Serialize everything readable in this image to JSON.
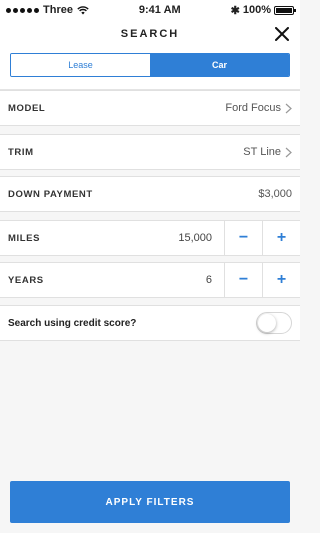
{
  "status_bar": {
    "carrier": "Three",
    "time": "9:41 AM",
    "battery": "100%",
    "battery_level": 1.0
  },
  "header": {
    "title": "SEARCH"
  },
  "segment": {
    "lease_label": "Lease",
    "car_label": "Car",
    "selected": "Car"
  },
  "fields": {
    "model": {
      "label": "MODEL",
      "value": "Ford Focus"
    },
    "trim": {
      "label": "TRIM",
      "value": "ST Line"
    },
    "down_payment": {
      "label": "DOWN PAYMENT",
      "value": "$3,000"
    },
    "miles": {
      "label": "MILES",
      "value": "15,000",
      "minus": "−",
      "plus": "+"
    },
    "years": {
      "label": "YEARS",
      "value": "6",
      "minus": "−",
      "plus": "+"
    }
  },
  "credit": {
    "label": "Search using credit score?",
    "enabled": false
  },
  "apply_button": {
    "label": "APPLY FILTERS"
  },
  "colors": {
    "accent": "#2f7fd6",
    "background": "#f6f6f6"
  }
}
